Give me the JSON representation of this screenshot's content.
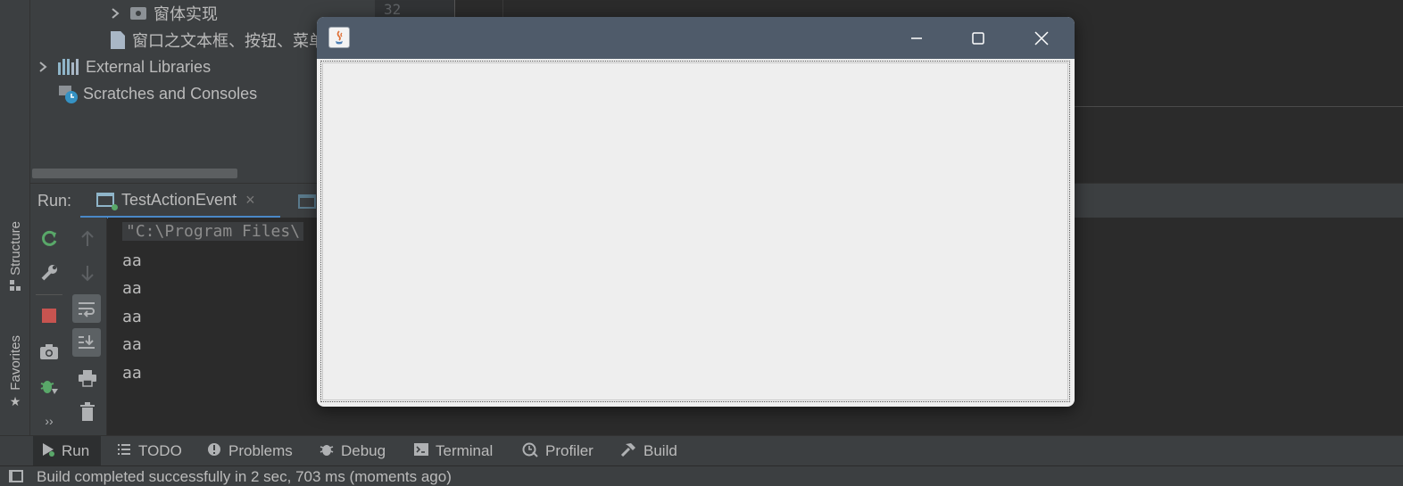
{
  "project_tree": {
    "items": [
      {
        "label": "窗体实现",
        "icon": "folder-icon",
        "expanded": false
      },
      {
        "label": "窗口之文本框、按钮、菜单",
        "icon": "file-icon"
      },
      {
        "label": "External Libraries",
        "icon": "libraries-icon",
        "expanded": false
      },
      {
        "label": "Scratches and Consoles",
        "icon": "scratches-icon"
      }
    ]
  },
  "editor": {
    "line_number": "32"
  },
  "side_tabs": {
    "structure": "Structure",
    "favorites": "Favorites"
  },
  "run_window": {
    "title": "Run:",
    "tab_label": "TestActionEvent",
    "close_icon": "×",
    "more_icon": "››"
  },
  "console": {
    "command": "\"C:\\Program Files\\",
    "lines": [
      "aa",
      "aa",
      "aa",
      "aa",
      "aa"
    ]
  },
  "bottom_bar": {
    "items": [
      {
        "label": "Run",
        "icon": "run-icon"
      },
      {
        "label": "TODO",
        "icon": "todo-icon"
      },
      {
        "label": "Problems",
        "icon": "problems-icon"
      },
      {
        "label": "Debug",
        "icon": "debug-icon"
      },
      {
        "label": "Terminal",
        "icon": "terminal-icon"
      },
      {
        "label": "Profiler",
        "icon": "profiler-icon"
      },
      {
        "label": "Build",
        "icon": "build-icon"
      }
    ]
  },
  "status_bar": {
    "message": "Build completed successfully in 2 sec, 703 ms (moments ago)"
  },
  "java_window": {
    "title": "",
    "app_icon": "java-icon"
  },
  "colors": {
    "accent_tab_underline": "#4a88c7",
    "run_green": "#59a869",
    "stop_red": "#c75450",
    "java_titlebar": "#4f5b6a"
  }
}
